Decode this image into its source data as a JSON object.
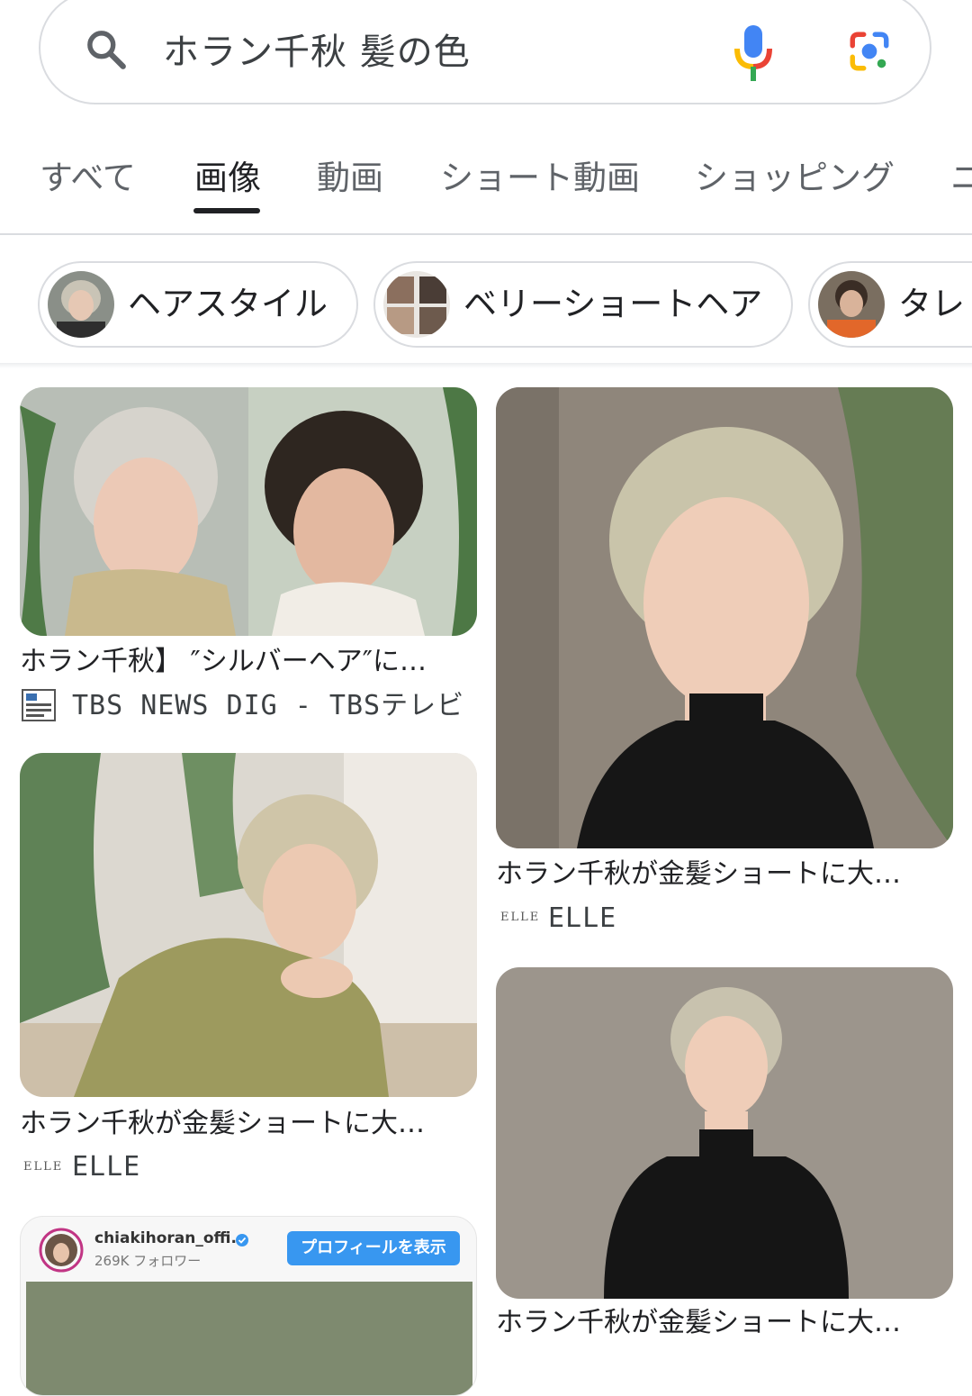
{
  "search": {
    "query": "ホラン千秋 髪の色"
  },
  "tabs": [
    {
      "label": "すべて",
      "active": false
    },
    {
      "label": "画像",
      "active": true
    },
    {
      "label": "動画",
      "active": false
    },
    {
      "label": "ショート動画",
      "active": false
    },
    {
      "label": "ショッピング",
      "active": false
    },
    {
      "label": "ニ",
      "active": false
    }
  ],
  "chips": [
    {
      "label": "ヘアスタイル"
    },
    {
      "label": "ベリーショートヘア"
    },
    {
      "label": "タレ"
    }
  ],
  "results": [
    {
      "title": "ホラン千秋】 ″シルバーヘア″に…",
      "source": "TBS NEWS DIG - TBSテレビ",
      "source_icon_text": "TBS NEWS DIG"
    },
    {
      "title": "ホラン千秋が金髪ショートに大…",
      "source": "ELLE",
      "source_icon_text": "ELLE"
    },
    {
      "title": "ホラン千秋が金髪ショートに大…",
      "source": "ELLE",
      "source_icon_text": "ELLE"
    },
    {
      "title": "ホラン千秋が金髪ショートに大…"
    }
  ],
  "instagram_card": {
    "handle": "chiakihoran_offi...",
    "followers": "269K フォロワー",
    "button": "プロフィールを表示"
  },
  "colors": {
    "google_blue": "#4285F4",
    "google_red": "#EA4335",
    "google_yellow": "#FBBC05",
    "google_green": "#34A853",
    "instagram_button": "#3897f0"
  }
}
